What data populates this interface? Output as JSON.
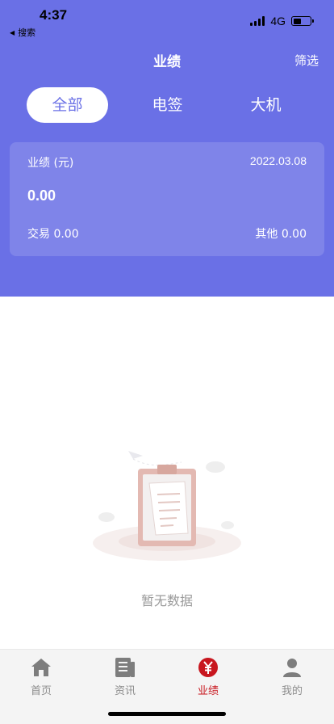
{
  "status_bar": {
    "time": "4:37",
    "back_app": "搜索",
    "network": "4G",
    "battery_level": 0.45
  },
  "header": {
    "title": "业绩",
    "filter_label": "筛选"
  },
  "tabs": [
    {
      "label": "全部",
      "active": true
    },
    {
      "label": "电签",
      "active": false
    },
    {
      "label": "大机",
      "active": false
    }
  ],
  "summary": {
    "label": "业绩 (元)",
    "date": "2022.03.08",
    "amount": "0.00",
    "trade_label": "交易 0.00",
    "other_label": "其他 0.00"
  },
  "empty_state": {
    "text": "暂无数据"
  },
  "tabbar": {
    "items": [
      {
        "label": "首页",
        "icon": "home-icon",
        "active": false
      },
      {
        "label": "资讯",
        "icon": "news-icon",
        "active": false
      },
      {
        "label": "业绩",
        "icon": "yen-icon",
        "active": true
      },
      {
        "label": "我的",
        "icon": "user-icon",
        "active": false
      }
    ]
  },
  "colors": {
    "primary": "#6a70e6",
    "active_nav": "#c8161e",
    "inactive_nav": "#8c8c8c"
  }
}
